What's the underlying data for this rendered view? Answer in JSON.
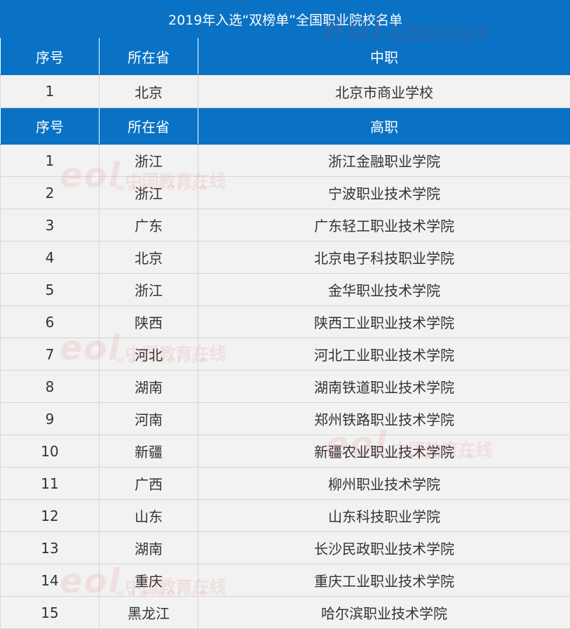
{
  "title": "2019年入选“双榜单”全国职业院校名单",
  "headers": [
    "序号",
    "所在省",
    "中职"
  ],
  "headers2": [
    "序号",
    "所在省",
    "高职"
  ],
  "secondary": [
    {
      "no": "1",
      "province": "北京",
      "school": "北京市商业学校"
    }
  ],
  "vocational": [
    {
      "no": "1",
      "province": "浙江",
      "school": "浙江金融职业学院"
    },
    {
      "no": "2",
      "province": "浙江",
      "school": "宁波职业技术学院"
    },
    {
      "no": "3",
      "province": "广东",
      "school": "广东轻工职业技术学院"
    },
    {
      "no": "4",
      "province": "北京",
      "school": "北京电子科技职业学院"
    },
    {
      "no": "5",
      "province": "浙江",
      "school": "金华职业技术学院"
    },
    {
      "no": "6",
      "province": "陕西",
      "school": "陕西工业职业技术学院"
    },
    {
      "no": "7",
      "province": "河北",
      "school": "河北工业职业技术学院"
    },
    {
      "no": "8",
      "province": "湖南",
      "school": "湖南铁道职业技术学院"
    },
    {
      "no": "9",
      "province": "河南",
      "school": "郑州铁路职业技术学院"
    },
    {
      "no": "10",
      "province": "新疆",
      "school": "新疆农业职业技术学院"
    },
    {
      "no": "11",
      "province": "广西",
      "school": "柳州职业技术学院"
    },
    {
      "no": "12",
      "province": "山东",
      "school": "山东科技职业学院"
    },
    {
      "no": "13",
      "province": "湖南",
      "school": "长沙民政职业技术学院"
    },
    {
      "no": "14",
      "province": "重庆",
      "school": "重庆工业职业技术学院"
    },
    {
      "no": "15",
      "province": "黑龙江",
      "school": "哈尔滨职业技术学院"
    }
  ],
  "watermark": {
    "logo": "eol",
    "text": "中国教育在线",
    "url": "www.eol.cn"
  },
  "colors": {
    "header_bg": "#0a72c4",
    "row_bg": "#f2f2f2",
    "text": "#333333",
    "header_text": "#ffffff"
  }
}
